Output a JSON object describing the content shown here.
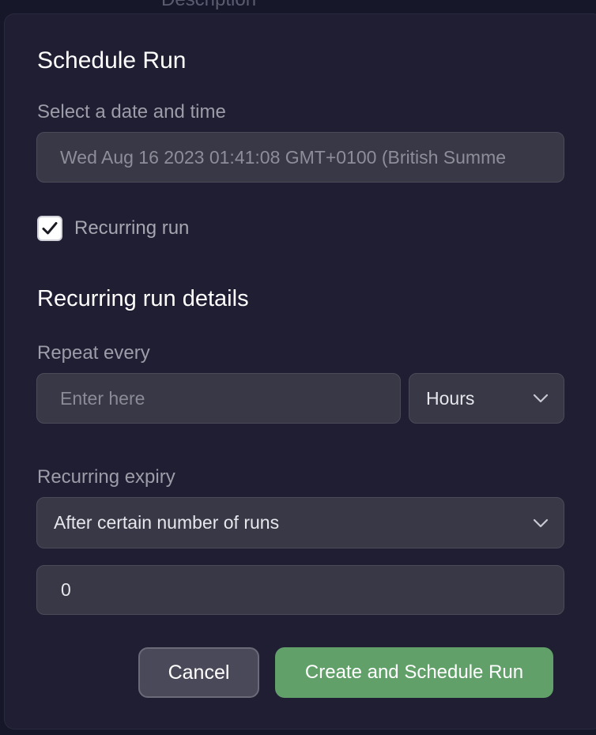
{
  "background": {
    "partial_heading": "Description"
  },
  "modal": {
    "title": "Schedule Run",
    "datetime": {
      "label": "Select a date and time",
      "value": "Wed Aug 16 2023 01:41:08 GMT+0100 (British Summe"
    },
    "recurring_checkbox": {
      "label": "Recurring run",
      "checked": true
    },
    "recurring_details": {
      "title": "Recurring run details",
      "repeat_every": {
        "label": "Repeat every",
        "placeholder": "Enter here",
        "unit": "Hours"
      },
      "expiry": {
        "label": "Recurring expiry",
        "selected": "After certain number of runs",
        "value": "0"
      }
    },
    "buttons": {
      "cancel": "Cancel",
      "create": "Create and Schedule Run"
    }
  },
  "colors": {
    "modal_bg": "#1f1e33",
    "field_bg": "#383846",
    "primary": "#62a06a",
    "secondary_button": "#4a4959"
  },
  "icons": {
    "checkbox": "checkmark-icon",
    "select": "chevron-down-icon"
  }
}
